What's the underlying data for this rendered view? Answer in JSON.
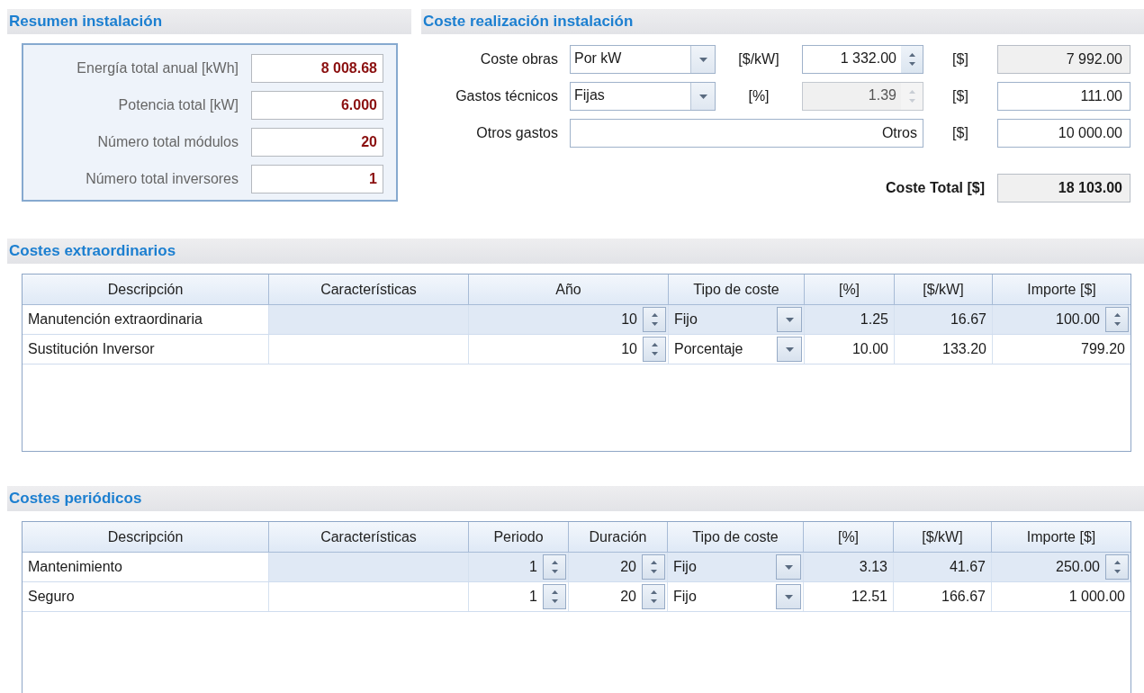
{
  "summary": {
    "title": "Resumen instalación",
    "fields": [
      {
        "label": "Energía total anual [kWh]",
        "value": "8 008.68"
      },
      {
        "label": "Potencia total [kW]",
        "value": "6.000"
      },
      {
        "label": "Número total módulos",
        "value": "20"
      },
      {
        "label": "Número total inversores",
        "value": "1"
      }
    ]
  },
  "cost": {
    "title": "Coste realización instalación",
    "rows": [
      {
        "kind": "combo",
        "label": "Coste obras",
        "option": "Por kW",
        "unit": "[$/kW]",
        "input": "1 332.00",
        "input_disabled": false,
        "currency": "[$]",
        "amount": "7 992.00",
        "amount_readonly": true
      },
      {
        "kind": "combo",
        "label": "Gastos técnicos",
        "option": "Fijas",
        "unit": "[%]",
        "input": "1.39",
        "input_disabled": true,
        "currency": "[$]",
        "amount": "111.00",
        "amount_readonly": false
      },
      {
        "kind": "text",
        "label": "Otros gastos",
        "value": "Otros",
        "currency": "[$]",
        "amount": "10 000.00",
        "amount_readonly": false
      }
    ],
    "total": {
      "label": "Coste Total [$]",
      "value": "18 103.00"
    }
  },
  "tables": [
    {
      "title": "Costes extraordinarios",
      "columns": [
        "Descripción",
        "Características",
        "Año",
        "Tipo de coste",
        "[%]",
        "[$/kW]",
        "Importe [$]"
      ],
      "rows": [
        {
          "selected": true,
          "cells": [
            {
              "kind": "text",
              "value": "Manutención extraordinaria"
            },
            {
              "kind": "empty"
            },
            {
              "kind": "spin",
              "value": "10"
            },
            {
              "kind": "combo",
              "value": "Fijo"
            },
            {
              "kind": "number",
              "value": "1.25"
            },
            {
              "kind": "number",
              "value": "16.67"
            },
            {
              "kind": "number",
              "value": "100.00"
            }
          ]
        },
        {
          "selected": false,
          "cells": [
            {
              "kind": "text",
              "value": "Sustitución Inversor"
            },
            {
              "kind": "empty"
            },
            {
              "kind": "spin",
              "value": "10"
            },
            {
              "kind": "combo",
              "value": "Porcentaje"
            },
            {
              "kind": "number",
              "value": "10.00"
            },
            {
              "kind": "number",
              "value": "133.20"
            },
            {
              "kind": "number",
              "value": "799.20"
            }
          ]
        }
      ]
    },
    {
      "title": "Costes periódicos",
      "columns": [
        "Descripción",
        "Características",
        "Periodo",
        "Duración",
        "Tipo de coste",
        "[%]",
        "[$/kW]",
        "Importe [$]"
      ],
      "rows": [
        {
          "selected": true,
          "cells": [
            {
              "kind": "text",
              "value": "Mantenimiento"
            },
            {
              "kind": "empty"
            },
            {
              "kind": "spin",
              "value": "1"
            },
            {
              "kind": "spin",
              "value": "20"
            },
            {
              "kind": "combo",
              "value": "Fijo"
            },
            {
              "kind": "number",
              "value": "3.13"
            },
            {
              "kind": "number",
              "value": "41.67"
            },
            {
              "kind": "number",
              "value": "250.00"
            }
          ]
        },
        {
          "selected": false,
          "cells": [
            {
              "kind": "text",
              "value": "Seguro"
            },
            {
              "kind": "empty"
            },
            {
              "kind": "spin",
              "value": "1"
            },
            {
              "kind": "spin",
              "value": "20"
            },
            {
              "kind": "combo",
              "value": "Fijo"
            },
            {
              "kind": "number",
              "value": "12.51"
            },
            {
              "kind": "number",
              "value": "166.67"
            },
            {
              "kind": "number",
              "value": "1 000.00"
            }
          ]
        }
      ]
    }
  ]
}
